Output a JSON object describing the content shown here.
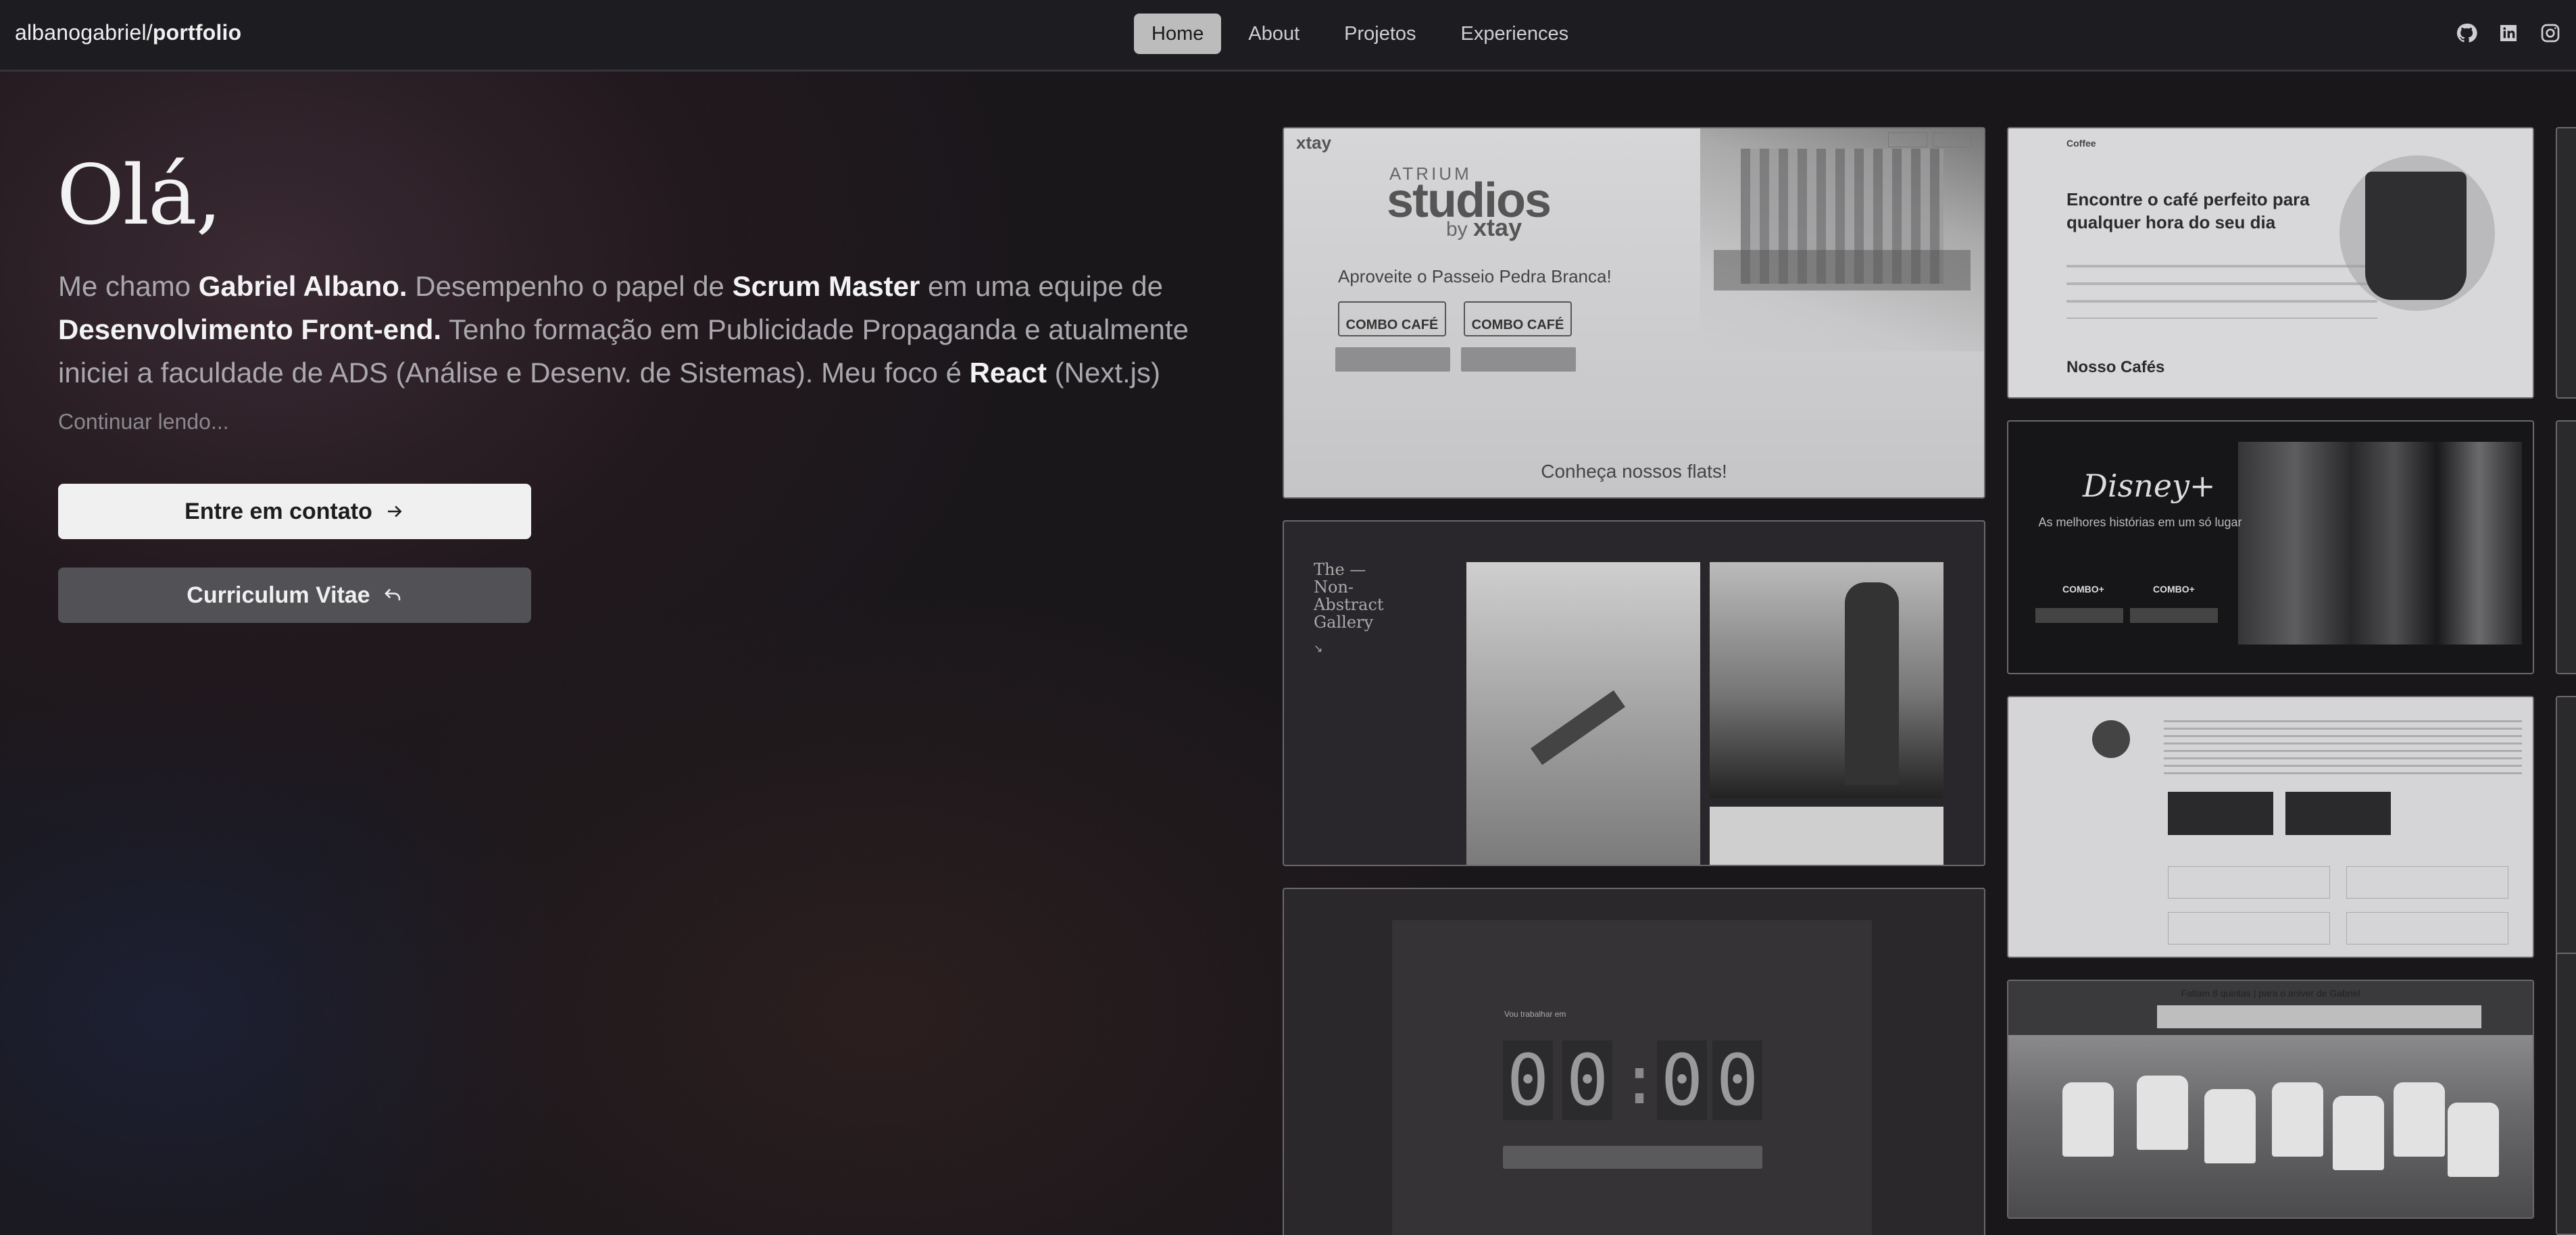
{
  "nav": {
    "brand_user": "albanogabriel/",
    "brand_repo": "portfolio",
    "links": [
      "Home",
      "About",
      "Projetos",
      "Experiences"
    ],
    "active": "Home",
    "socials": [
      "github-icon",
      "linkedin-icon",
      "instagram-icon"
    ]
  },
  "hero": {
    "title": "Olá,",
    "intro_parts": [
      "Me chamo ",
      "Gabriel Albano.",
      " Desempenho o papel de ",
      "Scrum Master",
      " em uma equipe de ",
      "Desenvolvimento Front-end.",
      " Tenho formação em Publicidade Propaganda e atualmente iniciei a faculdade de ADS (Análise e Desenv. de Sistemas). Meu foco é ",
      "React",
      " (Next.js)"
    ],
    "read_more": "Continuar lendo...",
    "contact_button": "Entre em contato",
    "cv_button": "Curriculum Vitae"
  },
  "projects": {
    "atrium": {
      "brand": "xtay",
      "small": "ATRIUM",
      "big": "studios",
      "by": "by",
      "by_brand": "xtay",
      "subtitle": "Aproveite o Passeio Pedra Branca!",
      "combo": "COMBO CAFÉ",
      "caption": "Conheça nossos flats!"
    },
    "gallery": {
      "title": "The — Non- Abstract Gallery",
      "arrow": "↘"
    },
    "coffee": {
      "logo": "Coffee",
      "heading": "Encontre o café perfeito para qualquer hora do seu dia",
      "footer": "Nosso Cafés"
    },
    "disney": {
      "logo": "Disney+",
      "heading": "As melhores histórias em um só lugar",
      "combo": "COMBO+"
    },
    "timer": {
      "label": "Vou trabalhar em",
      "digits": [
        "0",
        "0",
        "0",
        "0"
      ],
      "colon": ":"
    },
    "people": {
      "banner": "Faltam 8 quintas | para o aniver de Gabriel"
    }
  },
  "colors": {
    "background": "#1a171b",
    "nav_active": "#bcbcbc",
    "button_primary": "#f0f0f0",
    "button_secondary": "#525256"
  }
}
